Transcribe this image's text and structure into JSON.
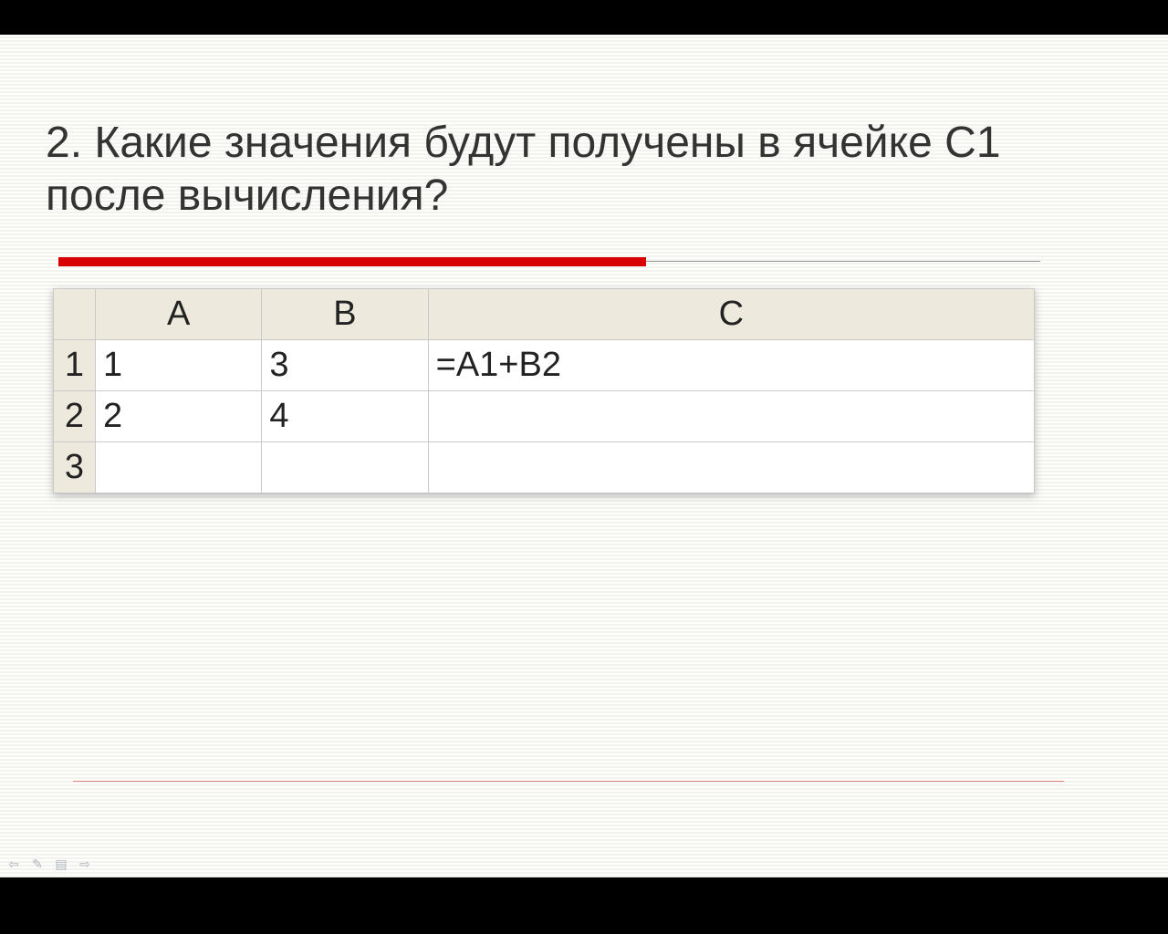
{
  "title": "2. Какие значения будут получены в ячейке С1 после вычисления?",
  "spreadsheet": {
    "columns": [
      "A",
      "B",
      "C"
    ],
    "rows": [
      {
        "num": "1",
        "cells": [
          "1",
          "3",
          "=A1+B2"
        ]
      },
      {
        "num": "2",
        "cells": [
          "2",
          "4",
          ""
        ]
      },
      {
        "num": "3",
        "cells": [
          "",
          "",
          ""
        ]
      }
    ]
  },
  "nav": {
    "back": "⇦",
    "pen": "✎",
    "menu": "▤",
    "fwd": "⇨"
  }
}
